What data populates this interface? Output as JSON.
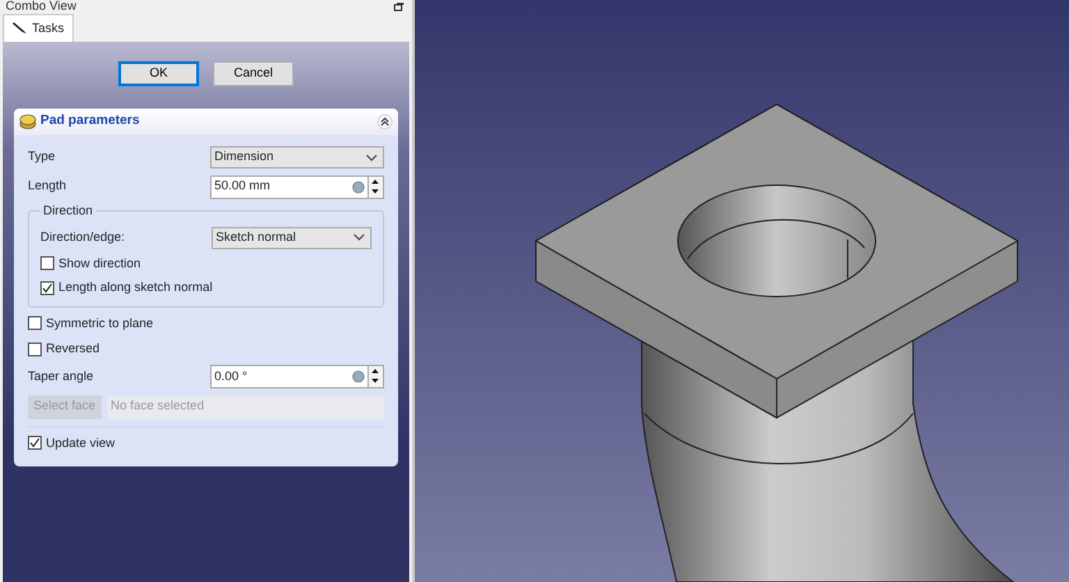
{
  "panel": {
    "title": "Combo View"
  },
  "tabs": [
    {
      "label": "Tasks",
      "selected": true
    }
  ],
  "buttons": [
    {
      "label": "OK",
      "default": true
    },
    {
      "label": "Cancel",
      "default": false
    }
  ],
  "pad_parameters": {
    "title": "Pad parameters",
    "type": {
      "label": "Type",
      "value": "Dimension"
    },
    "length": {
      "label": "Length",
      "value": "50.00 mm"
    },
    "direction": {
      "title": "Direction",
      "edge": {
        "label": "Direction/edge:",
        "value": "Sketch normal"
      },
      "checkboxes": [
        {
          "label": "Show direction",
          "checked": false
        },
        {
          "label": "Length along sketch normal",
          "checked": true
        }
      ]
    },
    "options": [
      {
        "label": "Symmetric to plane",
        "checked": false
      },
      {
        "label": "Reversed",
        "checked": false
      }
    ],
    "taper_angle": {
      "label": "Taper angle",
      "value": "0.00 °"
    },
    "select_face": {
      "button": "Select face",
      "disabled": true,
      "value": "No face selected"
    },
    "update_view": {
      "label": "Update view",
      "checked": true
    }
  }
}
